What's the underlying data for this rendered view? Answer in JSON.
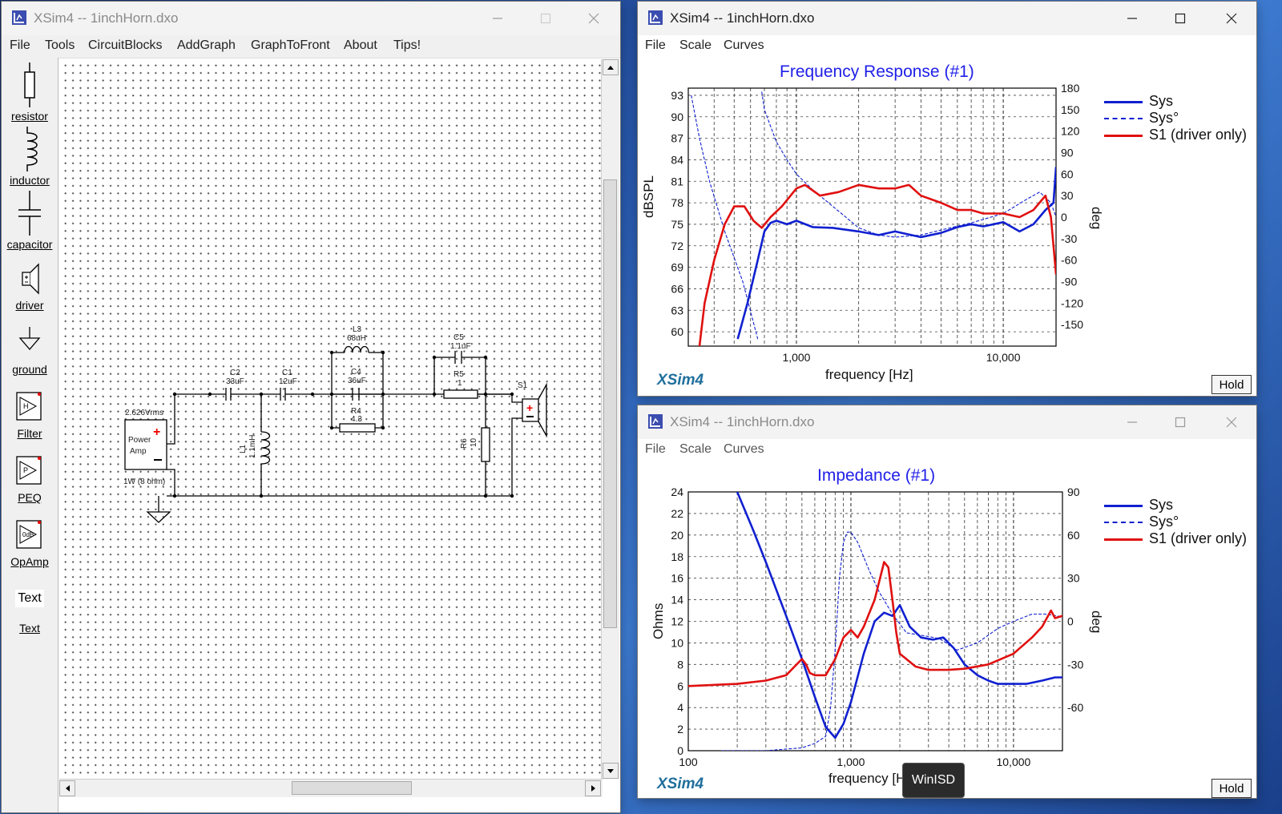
{
  "circuit_window": {
    "title": "XSim4 -- 1inchHorn.dxo",
    "menu": [
      "File",
      "Tools",
      "CircuitBlocks",
      "AddGraph",
      "GraphToFront",
      "About",
      "Tips!"
    ],
    "tools": [
      {
        "label": "resistor",
        "icon": "resistor-icon"
      },
      {
        "label": "inductor",
        "icon": "inductor-icon"
      },
      {
        "label": "capacitor",
        "icon": "capacitor-icon"
      },
      {
        "label": "driver",
        "icon": "driver-icon"
      },
      {
        "label": "ground",
        "icon": "ground-icon"
      },
      {
        "label": "Filter",
        "icon": "filter-icon"
      },
      {
        "label": "PEQ",
        "icon": "peq-icon"
      },
      {
        "label": "OpAmp",
        "icon": "opamp-icon"
      },
      {
        "label": "Text",
        "icon": "text-icon",
        "icon_text": "Text"
      }
    ],
    "schematic": {
      "amp_voltage": "2.626Vrms",
      "amp_label_1": "Power",
      "amp_label_2": "Amp",
      "amp_power": "1W (8 ohm)",
      "c2": {
        "name": "C2",
        "value": "33uF"
      },
      "c1": {
        "name": "C1",
        "value": "12uF"
      },
      "l1": {
        "name": "L1",
        "value": "1.1mH"
      },
      "l3": {
        "name": "L3",
        "value": "68uH"
      },
      "c4": {
        "name": "C4",
        "value": "36uF"
      },
      "r4": {
        "name": "R4",
        "value": "4.3"
      },
      "c5": {
        "name": "C5",
        "value": "1.1uF"
      },
      "r5": {
        "name": "R5",
        "value": "1"
      },
      "r6": {
        "name": "R6",
        "value": "10"
      },
      "s1": {
        "name": "S1"
      }
    }
  },
  "freq_window": {
    "title": "XSim4 -- 1inchHorn.dxo",
    "menu": [
      "File",
      "Scale",
      "Curves"
    ],
    "brand": "XSim4",
    "hold": "Hold"
  },
  "imp_window": {
    "title": "XSim4 -- 1inchHorn.dxo",
    "menu": [
      "File",
      "Scale",
      "Curves"
    ],
    "brand": "XSim4",
    "hold": "Hold"
  },
  "tooltip": "WinISD",
  "colors": {
    "sys": "#1020d0",
    "driver": "#e01010",
    "title": "#2020e8",
    "brand": "#1f6f9c"
  },
  "chart_data": [
    {
      "type": "line",
      "title": "Frequency Response (#1)",
      "xlabel": "frequency [Hz]",
      "ylabel": "dBSPL",
      "y2label": "deg",
      "x_scale": "log",
      "xlim": [
        300,
        18000
      ],
      "ylim": [
        58,
        94
      ],
      "y2lim": [
        -180,
        180
      ],
      "x_ticks": [
        1000,
        10000
      ],
      "x_tick_labels": [
        "1,000",
        "10,000"
      ],
      "y_ticks": [
        60,
        63,
        66,
        69,
        72,
        75,
        78,
        81,
        84,
        87,
        90,
        93
      ],
      "y2_ticks": [
        -150,
        -120,
        -90,
        -60,
        -30,
        0,
        30,
        60,
        90,
        120,
        150,
        180
      ],
      "grid": true,
      "legend": "right",
      "series": [
        {
          "name": "Sys",
          "style": "solid-thick",
          "axis": "left",
          "x": [
            520,
            580,
            650,
            700,
            750,
            800,
            900,
            1000,
            1200,
            1500,
            2000,
            2500,
            3000,
            4000,
            5000,
            6000,
            7000,
            8000,
            10000,
            12000,
            14000,
            16000,
            17500,
            18000
          ],
          "y": [
            59,
            64,
            70,
            74,
            75.2,
            75.5,
            75,
            75.5,
            74.6,
            74.5,
            74,
            73.5,
            74,
            73.2,
            73.8,
            74.6,
            75,
            74.7,
            75.3,
            74,
            75,
            77,
            78,
            83
          ]
        },
        {
          "name": "Sys°",
          "style": "dashed-thin",
          "axis": "right",
          "x": [
            310,
            340,
            380,
            450,
            550,
            650,
            680,
            700,
            800,
            900,
            1000,
            1200,
            1500,
            2000,
            2500,
            3000,
            4000,
            5000,
            7000,
            10000,
            13000,
            15000,
            17000,
            18000
          ],
          "y": [
            170,
            110,
            50,
            -20,
            -90,
            -170,
            175,
            150,
            105,
            80,
            60,
            38,
            15,
            -15,
            -25,
            -28,
            -25,
            -18,
            -8,
            5,
            25,
            35,
            20,
            0
          ]
        },
        {
          "name": "S1 (driver only)",
          "style": "solid-thick",
          "axis": "left",
          "x": [
            340,
            360,
            400,
            450,
            500,
            560,
            620,
            680,
            750,
            850,
            1000,
            1100,
            1300,
            1600,
            2000,
            2500,
            3000,
            3500,
            4000,
            5000,
            6000,
            7000,
            8000,
            10000,
            12000,
            14000,
            16000,
            17000,
            17500,
            18000
          ],
          "y": [
            58,
            64,
            70,
            75,
            77.5,
            77.5,
            75.5,
            74.5,
            76,
            77.5,
            80,
            80.5,
            79,
            79.5,
            80.5,
            80,
            80,
            80.5,
            79,
            78,
            77,
            77,
            76.5,
            76.5,
            76,
            77,
            79,
            76,
            72,
            68
          ]
        }
      ]
    },
    {
      "type": "line",
      "title": "Impedance (#1)",
      "xlabel": "frequency [Hz]",
      "ylabel": "Ohms",
      "y2label": "deg",
      "x_scale": "log",
      "xlim": [
        100,
        20000
      ],
      "ylim": [
        0,
        24
      ],
      "y2lim": [
        -90,
        90
      ],
      "x_ticks": [
        100,
        1000,
        10000
      ],
      "x_tick_labels": [
        "100",
        "1,000",
        "10,000"
      ],
      "y_ticks": [
        0,
        2,
        4,
        6,
        8,
        10,
        12,
        14,
        16,
        18,
        20,
        22,
        24
      ],
      "y2_ticks": [
        -60,
        -30,
        0,
        30,
        60,
        90
      ],
      "grid": true,
      "legend": "right",
      "series": [
        {
          "name": "Sys",
          "style": "solid-thick",
          "axis": "left",
          "x": [
            200,
            250,
            300,
            400,
            500,
            600,
            700,
            800,
            900,
            1000,
            1200,
            1400,
            1600,
            1800,
            2000,
            2300,
            2700,
            3200,
            3700,
            4300,
            5000,
            6000,
            7000,
            8000,
            10000,
            12000,
            15000,
            18000,
            20000
          ],
          "y": [
            24,
            20.5,
            17.5,
            12.5,
            8.5,
            5,
            2.2,
            1.2,
            2.5,
            4.5,
            9,
            12,
            12.8,
            12.5,
            13.5,
            11.5,
            10.5,
            10.3,
            10.5,
            9.5,
            8,
            7,
            6.5,
            6.2,
            6.2,
            6.2,
            6.5,
            6.8,
            6.8
          ]
        },
        {
          "name": "Sys°",
          "style": "dashed-thin",
          "axis": "right",
          "x": [
            160,
            300,
            500,
            600,
            700,
            750,
            800,
            850,
            900,
            950,
            1000,
            1100,
            1300,
            1500,
            1800,
            2200,
            2800,
            3500,
            4500,
            6000,
            8000,
            10000,
            13000,
            16000,
            20000
          ],
          "y": [
            -90,
            -90,
            -88,
            -85,
            -80,
            -60,
            -20,
            30,
            55,
            62,
            62,
            55,
            35,
            20,
            5,
            -8,
            -10,
            -12,
            -20,
            -15,
            -5,
            0,
            5,
            5,
            3
          ]
        },
        {
          "name": "S1 (driver only)",
          "style": "solid-thick",
          "axis": "left",
          "x": [
            100,
            200,
            300,
            400,
            450,
            500,
            530,
            560,
            600,
            700,
            800,
            900,
            1000,
            1100,
            1200,
            1400,
            1600,
            1700,
            1800,
            1900,
            2000,
            2500,
            3000,
            4000,
            5000,
            7000,
            10000,
            13000,
            15000,
            17000,
            18000,
            20000
          ],
          "y": [
            6,
            6.2,
            6.5,
            7,
            7.8,
            8.5,
            8,
            7.2,
            7,
            7,
            8.5,
            10.5,
            11.2,
            10.5,
            11.5,
            14,
            17.5,
            17,
            14,
            11,
            9,
            7.8,
            7.5,
            7.5,
            7.6,
            8,
            9,
            10.5,
            11.5,
            13,
            12.3,
            12.5
          ]
        }
      ]
    }
  ]
}
